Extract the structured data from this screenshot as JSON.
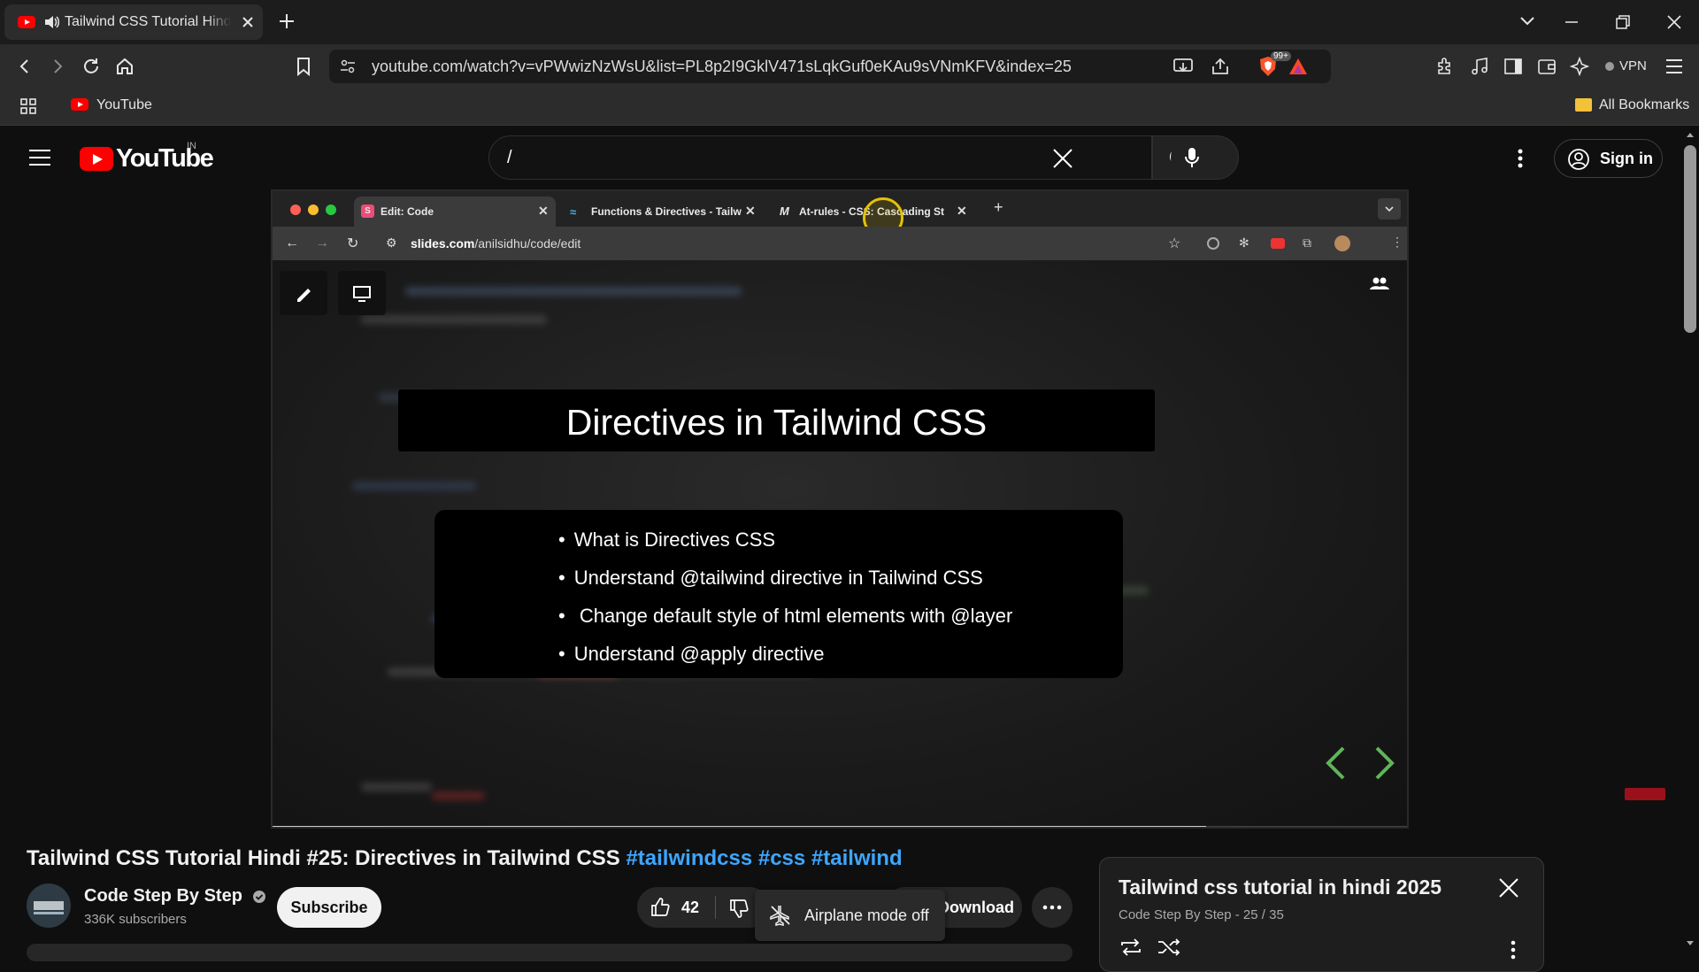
{
  "browser": {
    "tab_title": "Tailwind CSS Tutorial Hindi #",
    "url": "youtube.com/watch?v=vPWwizNzWsU&list=PL8p2I9GklV471sLqkGuf0eKAu9sVNmKFV&index=25",
    "bookmark_youtube": "YouTube",
    "all_bookmarks": "All Bookmarks",
    "vpn_label": "VPN",
    "brave_badge": "99+"
  },
  "youtube": {
    "wordmark": "YouTube",
    "region": "IN",
    "search_value": "/",
    "sign_in": "Sign in"
  },
  "video": {
    "inner_tabs": [
      {
        "label": "Edit: Code"
      },
      {
        "label": "Functions & Directives - Tailw"
      },
      {
        "label": "At-rules - CSS: Cascading St"
      }
    ],
    "inner_url_host": "slides.com",
    "inner_url_path": "/anilsidhu/code/edit",
    "slide_title": "Directives in Tailwind CSS",
    "bullets": [
      "What is Directives CSS",
      "Understand @tailwind directive in Tailwind CSS",
      " Change default style of html elements with @layer",
      "Understand @apply directive"
    ],
    "progress_fraction": 0.82
  },
  "details": {
    "title": "Tailwind CSS Tutorial Hindi #25: Directives in Tailwind CSS",
    "hashtags": [
      "#tailwindcss",
      "#css",
      "#tailwind"
    ],
    "channel_name": "Code Step By Step",
    "subscribers": "336K subscribers",
    "subscribe_label": "Subscribe",
    "like_count": "42",
    "download_label": "Download",
    "toast_text": "Airplane mode off"
  },
  "playlist": {
    "title": "Tailwind css tutorial in hindi 2025",
    "subtitle": "Code Step By Step - 25 / 35"
  },
  "colors": {
    "youtube_red": "#ff0000",
    "hashtag_blue": "#3ea6ff",
    "cursor_highlight": "#e6c200"
  }
}
